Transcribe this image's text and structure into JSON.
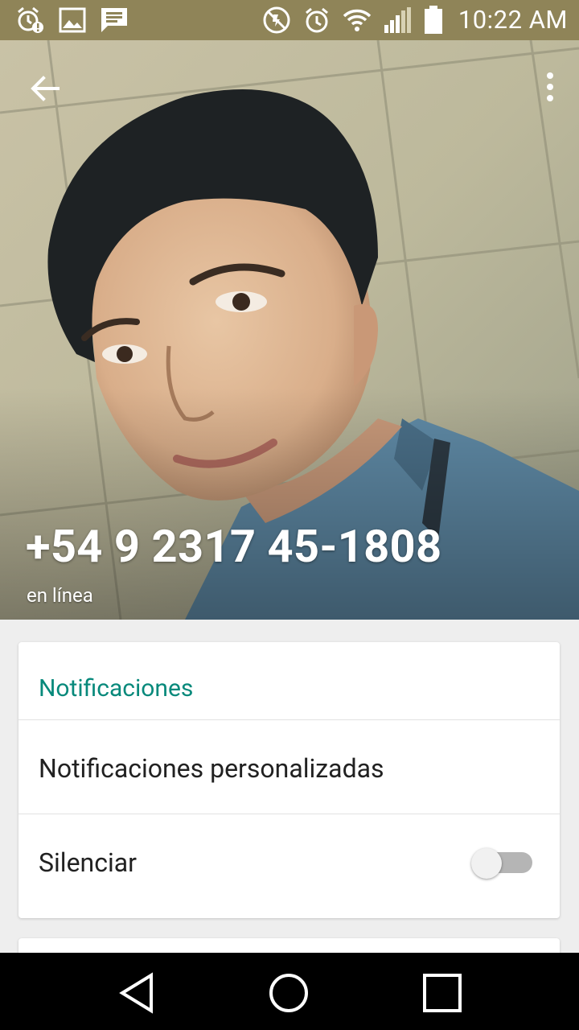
{
  "status_bar": {
    "time": "10:22 AM",
    "left_icons": [
      "alarm-warning-icon",
      "gallery-icon",
      "message-icon"
    ],
    "right_icons": [
      "mute-icon",
      "alarm-icon",
      "wifi-icon",
      "signal-icon",
      "battery-icon"
    ]
  },
  "header": {
    "back_icon": "back-arrow-icon",
    "menu_icon": "overflow-menu-icon",
    "contact_name": "+54 9 2317 45-1808",
    "status": "en línea"
  },
  "notifications_card": {
    "title": "Notificaciones",
    "custom_notifications_label": "Notificaciones personalizadas",
    "mute_label": "Silenciar",
    "mute_enabled": false
  },
  "colors": {
    "status_bar": "#8f8458",
    "accent": "#07897b",
    "background": "#eeeeee"
  },
  "nav_bar": {
    "icons": [
      "nav-back-icon",
      "nav-home-icon",
      "nav-recents-icon"
    ]
  }
}
